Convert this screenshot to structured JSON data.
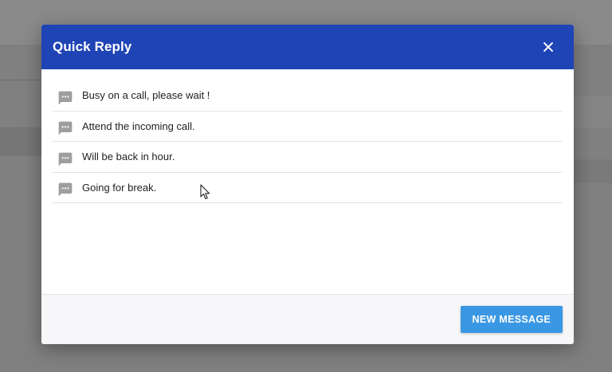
{
  "dialog": {
    "title": "Quick Reply",
    "close_icon": "close-icon"
  },
  "replies": [
    {
      "text": "Busy on a call, please wait !",
      "icon": "message-icon"
    },
    {
      "text": "Attend the incoming call.",
      "icon": "message-icon"
    },
    {
      "text": "Will be back in hour.",
      "icon": "message-icon"
    },
    {
      "text": "Going for break.",
      "icon": "message-icon"
    }
  ],
  "footer": {
    "new_message_label": "NEW MESSAGE"
  },
  "colors": {
    "header": "#1f44b5",
    "button": "#3a97e3",
    "icon": "#9e9e9e"
  }
}
